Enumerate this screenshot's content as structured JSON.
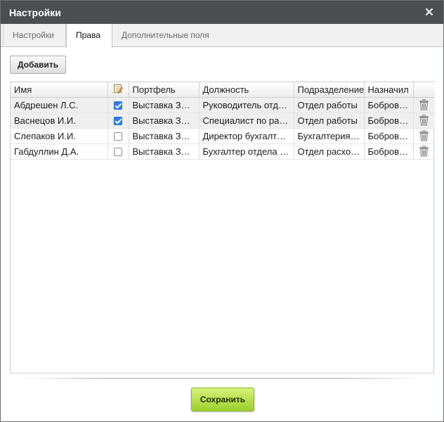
{
  "window": {
    "title": "Настройки"
  },
  "tabs": [
    {
      "label": "Настройки"
    },
    {
      "label": "Права"
    },
    {
      "label": "Дополнительные поля"
    }
  ],
  "active_tab": "Права",
  "toolbar": {
    "add_label": "Добавить"
  },
  "grid": {
    "columns": {
      "name": "Имя",
      "check_icon": "edit-permission-icon",
      "portfolio": "Портфель",
      "position": "Должность",
      "department": "Подразделение",
      "assigned_by": "Назначил"
    },
    "rows": [
      {
        "name": "Абдрешен Л.С.",
        "checked": true,
        "portfolio": "Выставка ЗОЖ",
        "position": "Руководитель отдела",
        "department": "Отдел работы",
        "assigned_by": "Бобров А."
      },
      {
        "name": "Васнецов И.И.",
        "checked": true,
        "portfolio": "Выставка ЗОЖ",
        "position": "Специалист по работе",
        "department": "Отдел работы",
        "assigned_by": "Бобров А."
      },
      {
        "name": "Слепаков И.И.",
        "checked": false,
        "portfolio": "Выставка ЗОЖ",
        "position": "Директор бухгалтерии",
        "department": "Бухгалтерия, финансы",
        "assigned_by": "Бобров А."
      },
      {
        "name": "Габдуллин Д.А.",
        "checked": false,
        "portfolio": "Выставка ЗОЖ",
        "position": "Бухгалтер отдела расходов",
        "department": "Отдел расходов",
        "assigned_by": "Бобров А."
      }
    ],
    "delete_icon": "trash-icon"
  },
  "footer": {
    "save_label": "Сохранить"
  },
  "colors": {
    "titlebar": "#4b4f52",
    "checkbox_on": "#2c7ee6",
    "save_button": "#9ccf2c"
  }
}
